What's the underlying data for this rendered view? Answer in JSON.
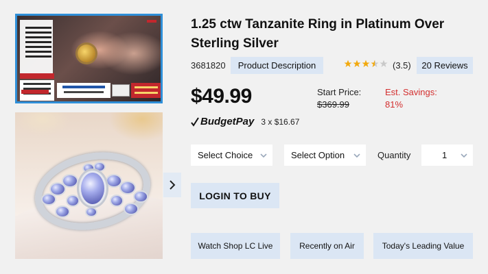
{
  "product": {
    "title": "1.25 ctw Tanzanite Ring in Platinum Over Sterling Silver",
    "item_number": "3681820",
    "description_button": "Product Description",
    "rating": 3.5,
    "rating_text": "(3.5)",
    "reviews_button": "20 Reviews"
  },
  "pricing": {
    "price": "$49.99",
    "start_price_label": "Start Price:",
    "start_price": "$369.99",
    "savings_label": "Est. Savings:",
    "savings_value": "81%"
  },
  "budgetpay": {
    "logo": "BudgetPay",
    "terms": "3 x $16.67"
  },
  "options": {
    "choice_label": "Select Choice",
    "option_label": "Select Option",
    "quantity_label": "Quantity",
    "quantity_value": "1"
  },
  "actions": {
    "login_to_buy": "LOGIN TO BUY",
    "watch_live": "Watch Shop LC Live",
    "recently_on_air": "Recently on Air",
    "todays_leading_value": "Today's Leading Value"
  },
  "colors": {
    "accent_button_bg": "#dbe6f4",
    "savings_red": "#d32f2f",
    "star_gold": "#f2a90d",
    "selected_border": "#2f8fd8"
  },
  "icons": {
    "carousel_next": "chevron-right-icon",
    "dropdown": "chevron-down-icon",
    "budgetpay_mark": "checkmark-icon"
  }
}
